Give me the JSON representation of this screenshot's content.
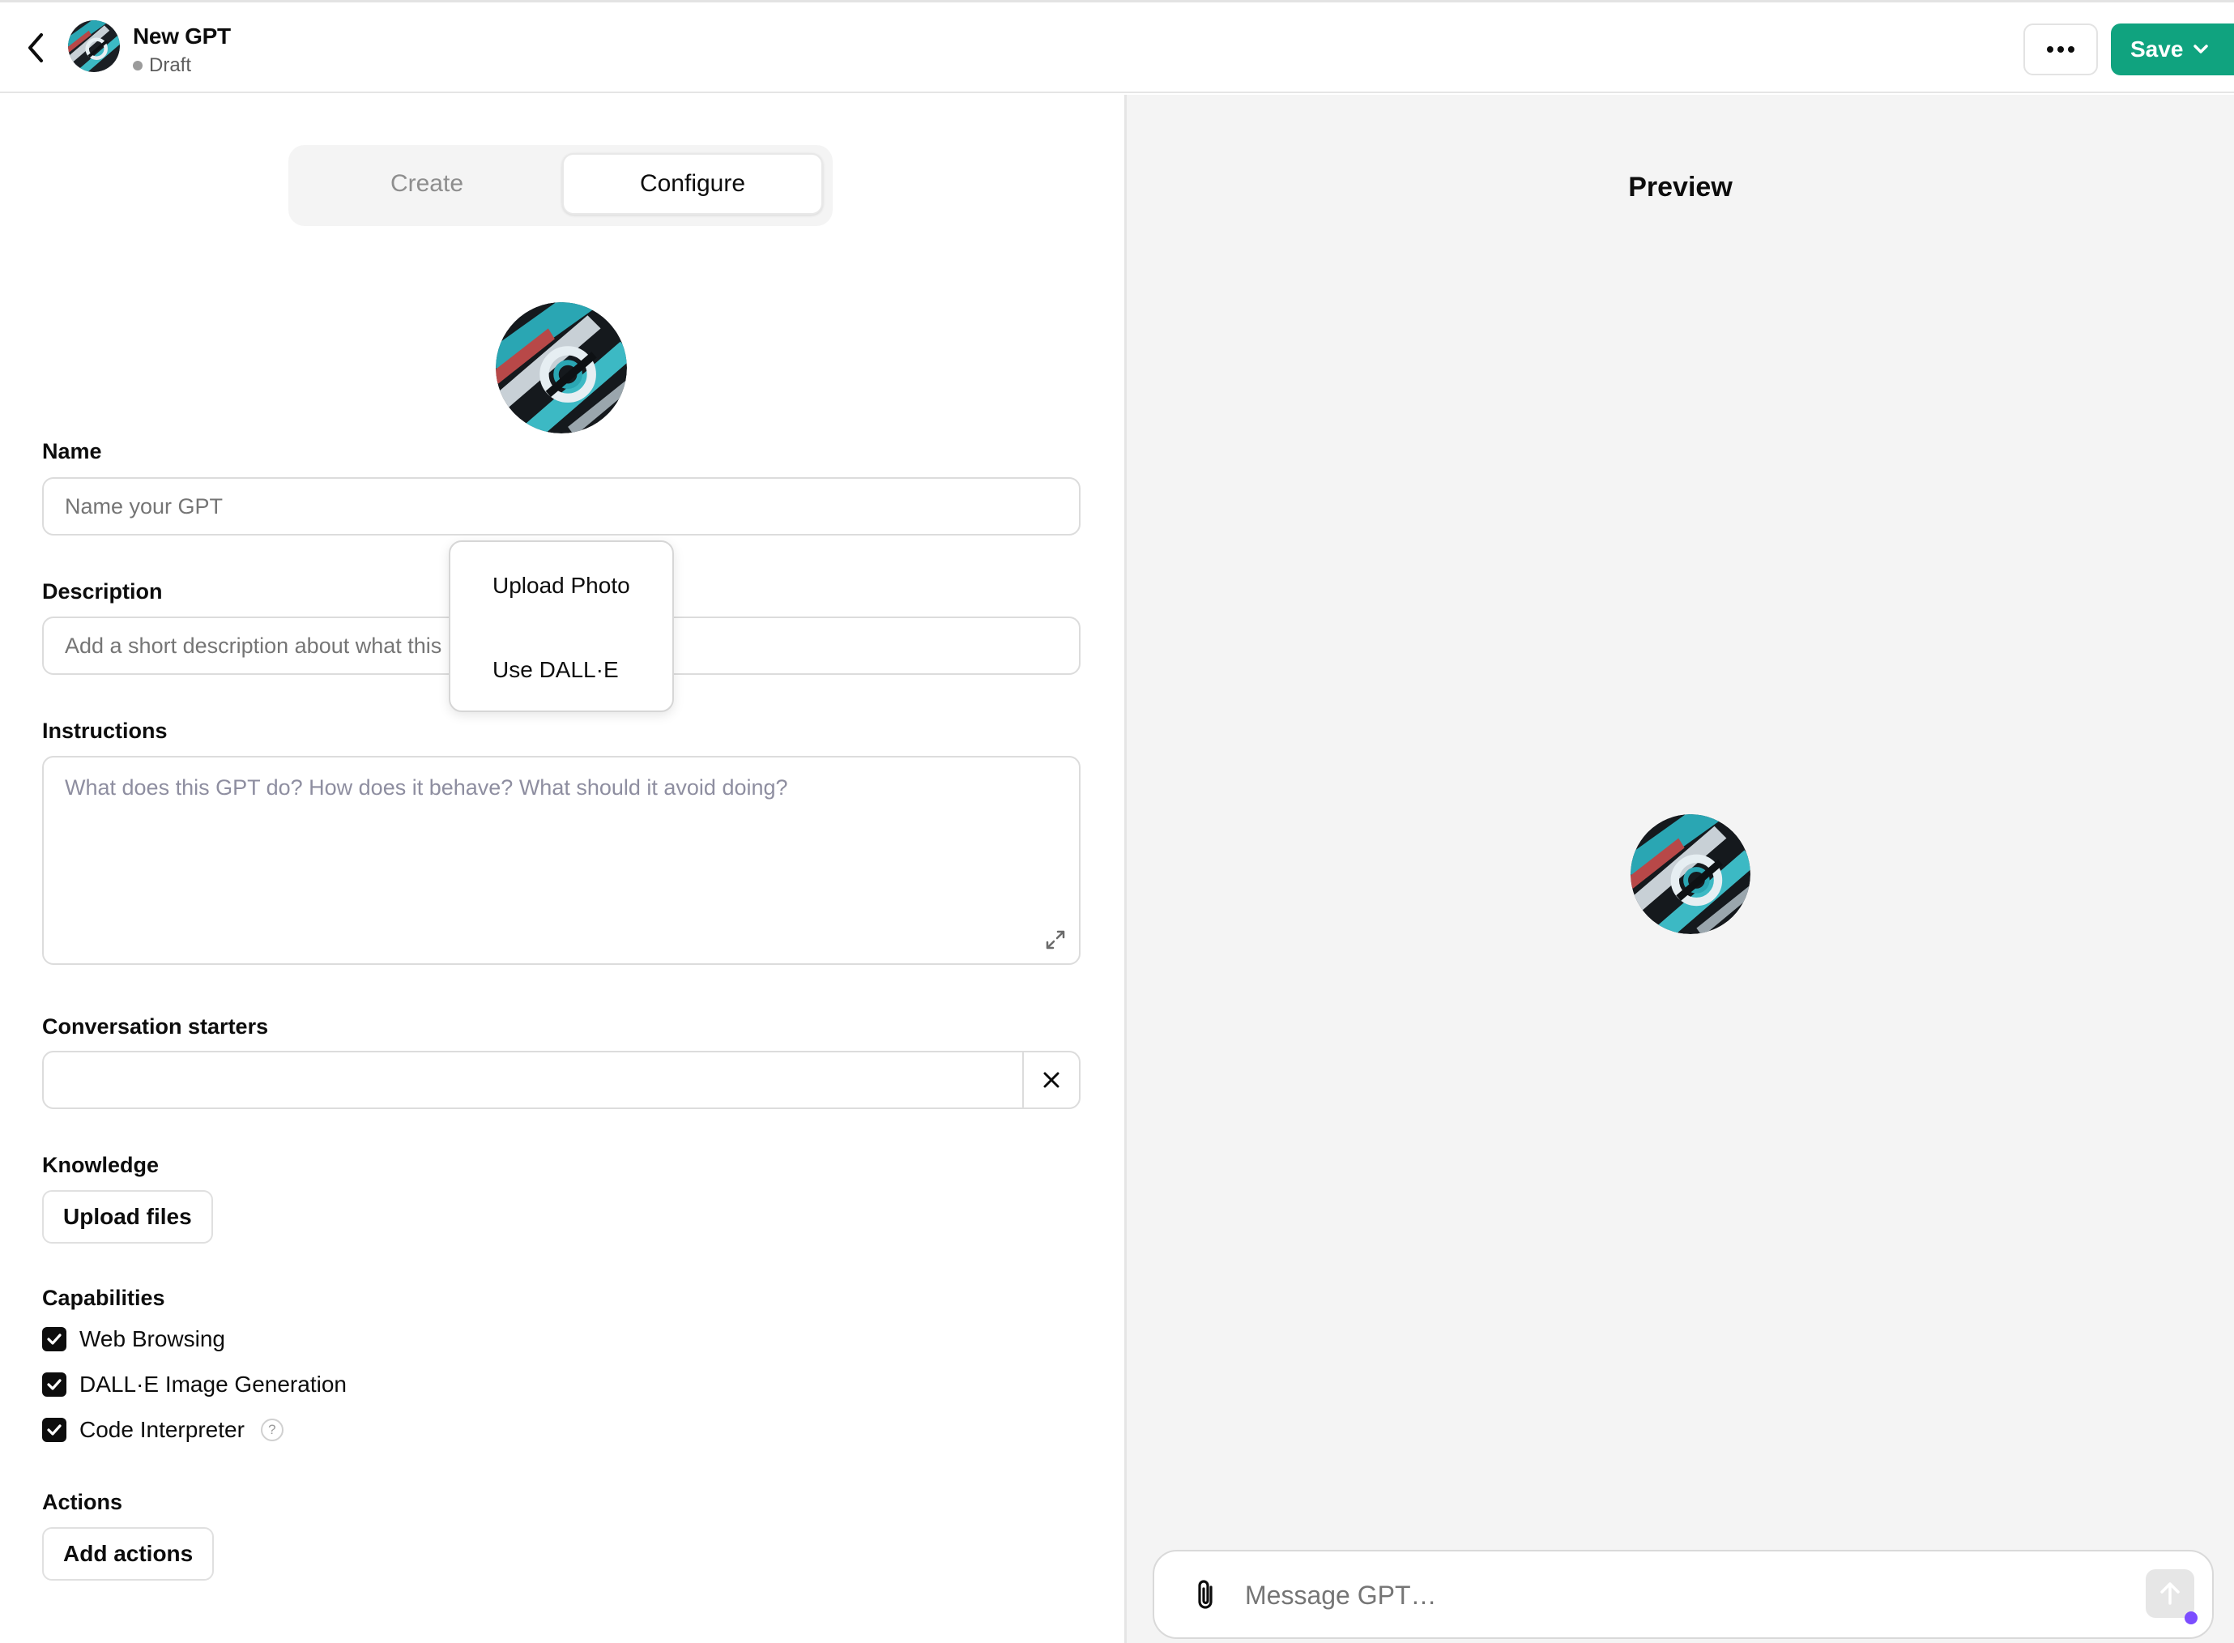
{
  "header": {
    "gpt_name": "New GPT",
    "status": "Draft",
    "save_label": "Save",
    "more_icon": "ellipsis-icon",
    "back_icon": "chevron-left-icon"
  },
  "tabs": [
    {
      "label": "Create",
      "active": false
    },
    {
      "label": "Configure",
      "active": true
    }
  ],
  "avatar_menu": {
    "items": [
      {
        "label": "Upload Photo"
      },
      {
        "label": "Use DALL·E"
      }
    ]
  },
  "form": {
    "name": {
      "label": "Name",
      "placeholder": "Name your GPT",
      "value": ""
    },
    "description": {
      "label": "Description",
      "placeholder": "Add a short description about what this GPT does",
      "value": ""
    },
    "instructions": {
      "label": "Instructions",
      "placeholder": "What does this GPT do? How does it behave? What should it avoid doing?",
      "value": ""
    },
    "conversation_starters": {
      "label": "Conversation starters",
      "value": ""
    },
    "knowledge": {
      "label": "Knowledge",
      "button": "Upload files"
    },
    "capabilities": {
      "label": "Capabilities",
      "items": [
        {
          "label": "Web Browsing",
          "checked": true
        },
        {
          "label": "DALL·E Image Generation",
          "checked": true
        },
        {
          "label": "Code Interpreter",
          "checked": true,
          "help": "?"
        }
      ]
    },
    "actions": {
      "label": "Actions",
      "button": "Add actions"
    }
  },
  "preview": {
    "title": "Preview",
    "composer_placeholder": "Message GPT…"
  },
  "colors": {
    "accent": "#10a37f",
    "panel_bg": "#f4f4f4",
    "checkbox": "#0d0d0d"
  }
}
